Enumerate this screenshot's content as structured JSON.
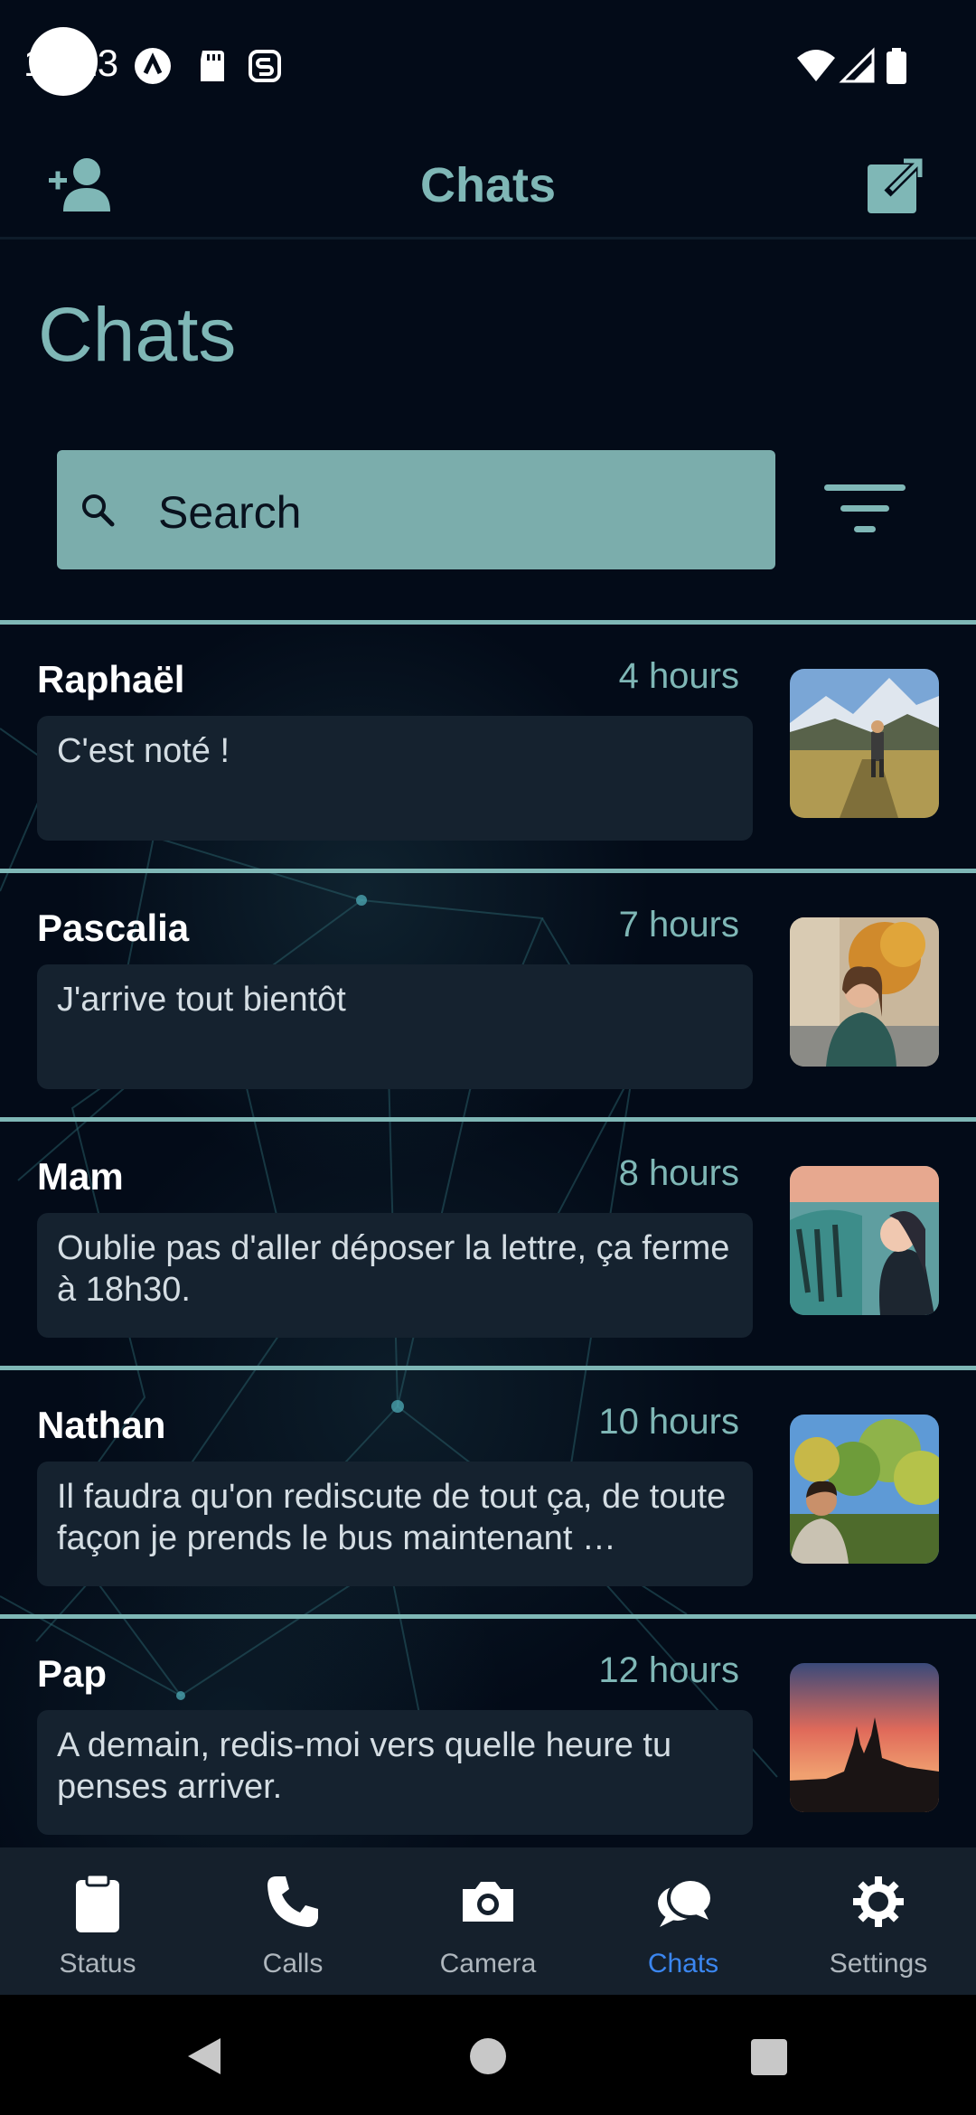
{
  "status_bar": {
    "time": "13:13",
    "icons": [
      "a-icon",
      "sd-card-icon",
      "s-icon",
      "wifi-icon",
      "signal-icon",
      "battery-icon"
    ]
  },
  "app_bar": {
    "title": "Chats",
    "left_icon": "add-contact-icon",
    "right_icon": "compose-icon"
  },
  "page_title": "Chats",
  "search": {
    "label": "Search",
    "icon": "search-icon",
    "filter_icon": "filter-icon"
  },
  "chats": [
    {
      "name": "Raphaël",
      "time": "4 hours",
      "message": "C'est noté !"
    },
    {
      "name": "Pascalia",
      "time": "7 hours",
      "message": "J'arrive tout bientôt"
    },
    {
      "name": "Mam",
      "time": "8 hours",
      "message": "Oublie pas d'aller déposer la lettre, ça ferme à 18h30."
    },
    {
      "name": "Nathan",
      "time": "10 hours",
      "message": "Il faudra qu'on rediscute de tout ça, de toute façon je prends le bus maintenant …"
    },
    {
      "name": "Pap",
      "time": "12 hours",
      "message": "A demain, redis-moi vers quelle heure tu penses arriver."
    }
  ],
  "bottom_nav": {
    "items": [
      {
        "label": "Status",
        "icon": "clipboard-icon"
      },
      {
        "label": "Calls",
        "icon": "phone-icon"
      },
      {
        "label": "Camera",
        "icon": "camera-icon"
      },
      {
        "label": "Chats",
        "icon": "chat-bubbles-icon"
      },
      {
        "label": "Settings",
        "icon": "gear-icon"
      }
    ],
    "active": "Chats"
  },
  "colors": {
    "accent": "#7fb7b6",
    "active_nav": "#3b86f0",
    "background": "#030b18",
    "bubble": "#15222f"
  }
}
